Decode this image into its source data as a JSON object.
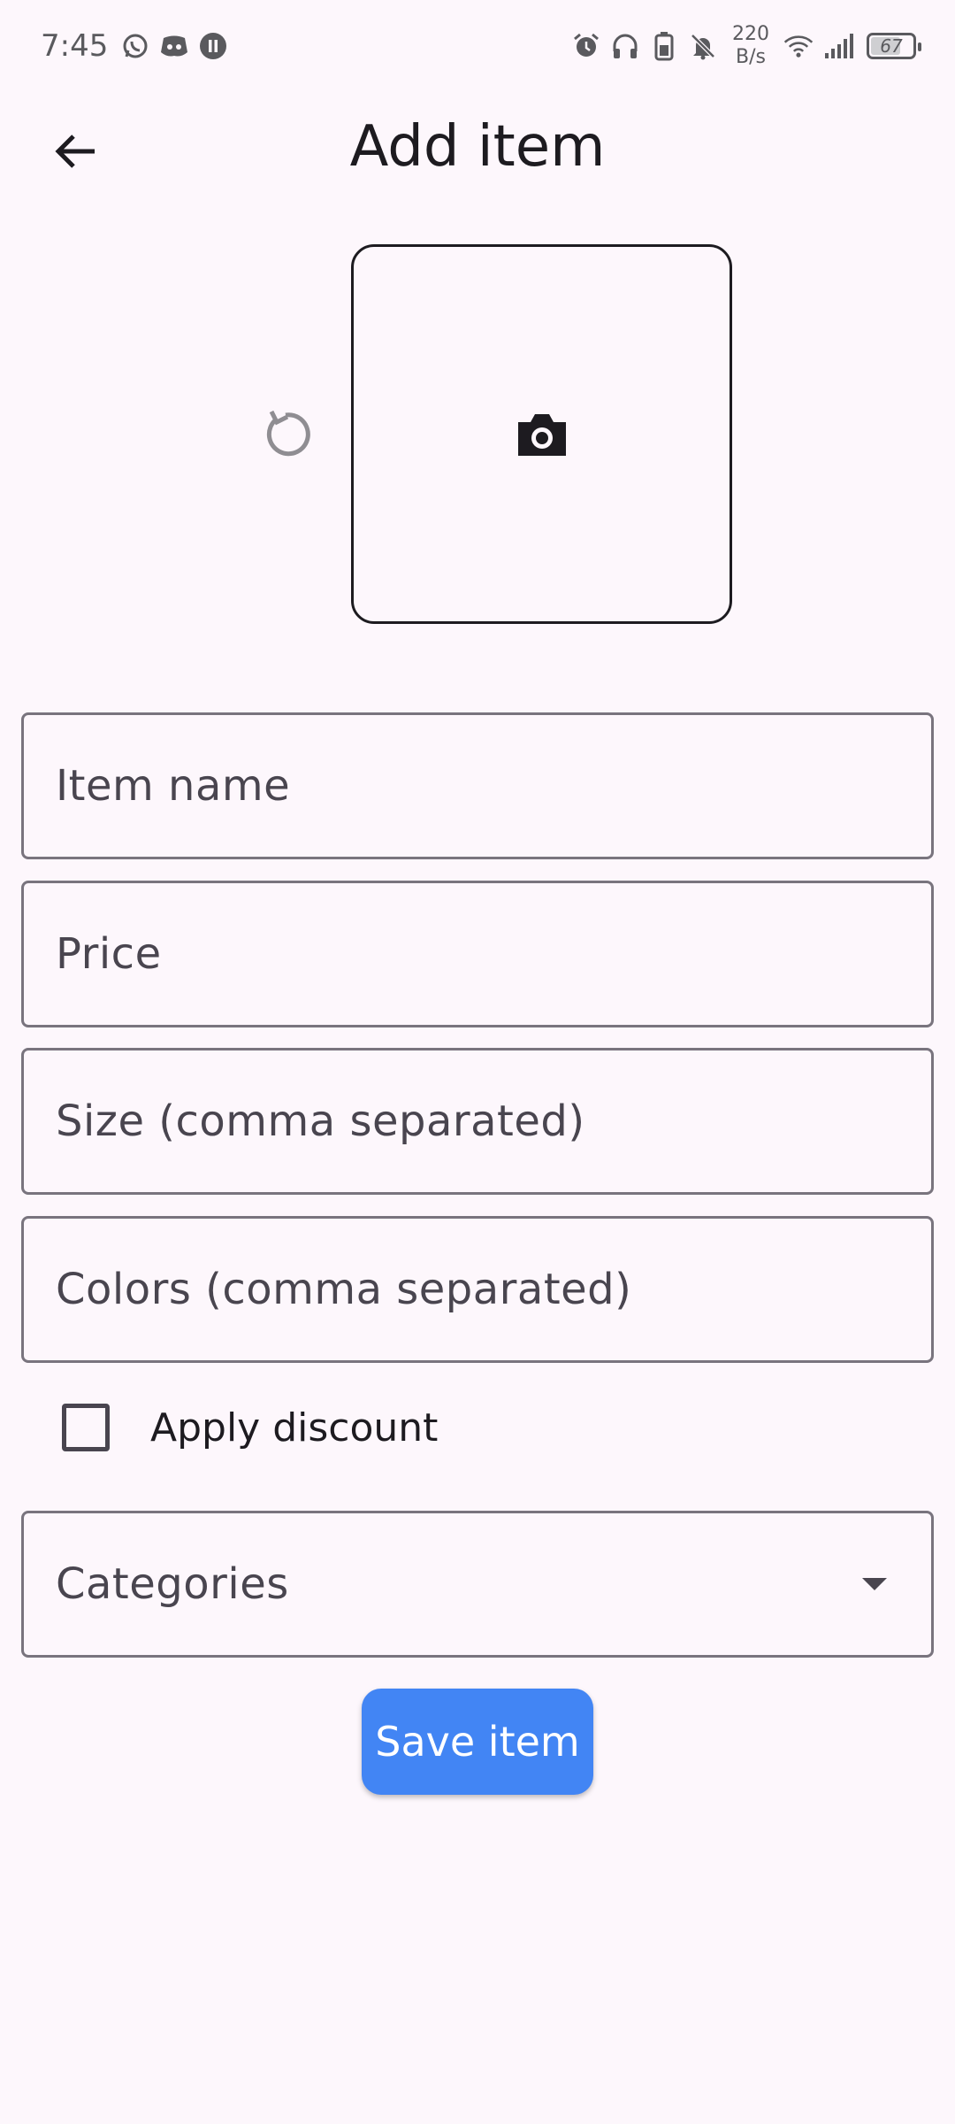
{
  "status_bar": {
    "time": "7:45",
    "speed_value": "220",
    "speed_unit": "B/s",
    "battery": "67",
    "icons": [
      "whatsapp-icon",
      "discord-icon",
      "pause-icon",
      "alarm-icon",
      "headphones-icon",
      "battery-saver-icon",
      "mute-icon",
      "wifi-icon",
      "signal-icon",
      "battery-icon"
    ]
  },
  "app_bar": {
    "title": "Add item",
    "back_icon": "arrow-back-icon"
  },
  "image_picker": {
    "reset_icon": "refresh-icon",
    "camera_icon": "camera-icon"
  },
  "form": {
    "item_name_placeholder": "Item name",
    "price_placeholder": "Price",
    "size_placeholder": "Size (comma separated)",
    "colors_placeholder": "Colors (comma separated)",
    "discount_label": "Apply discount",
    "discount_checked": false,
    "categories_placeholder": "Categories",
    "save_label": "Save item"
  },
  "colors": {
    "background": "#fdf7fc",
    "primary_button": "#4285f4",
    "outline": "#79747e",
    "text": "#1d1b20"
  }
}
